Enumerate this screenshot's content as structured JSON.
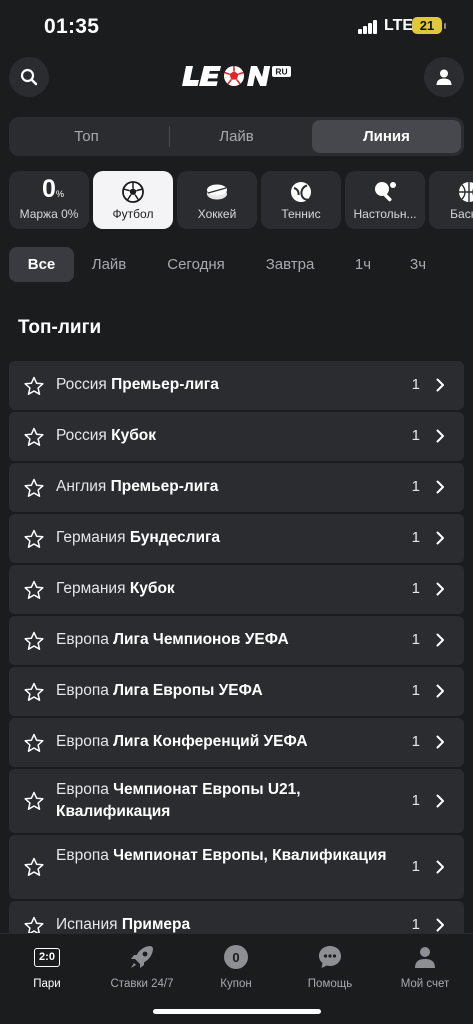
{
  "status": {
    "time": "01:35",
    "network": "LTE",
    "battery": "21"
  },
  "header": {
    "logo_text": "LEON",
    "logo_suffix": "RU"
  },
  "tabs": [
    {
      "label": "Топ",
      "active": false
    },
    {
      "label": "Лайв",
      "active": false
    },
    {
      "label": "Линия",
      "active": true
    }
  ],
  "sports": [
    {
      "label": "Маржа 0%",
      "value": "0",
      "unit": "%",
      "icon": "margin-icon",
      "active": false
    },
    {
      "label": "Футбол",
      "icon": "football-icon",
      "active": true
    },
    {
      "label": "Хоккей",
      "icon": "hockey-icon",
      "active": false
    },
    {
      "label": "Теннис",
      "icon": "tennis-icon",
      "active": false
    },
    {
      "label": "Настольн...",
      "icon": "table-tennis-icon",
      "active": false
    },
    {
      "label": "Баскет",
      "icon": "basketball-icon",
      "active": false
    }
  ],
  "filters": [
    {
      "label": "Все",
      "active": true
    },
    {
      "label": "Лайв",
      "active": false
    },
    {
      "label": "Сегодня",
      "active": false
    },
    {
      "label": "Завтра",
      "active": false
    },
    {
      "label": "1ч",
      "active": false
    },
    {
      "label": "3ч",
      "active": false
    }
  ],
  "section_title": "Топ-лиги",
  "leagues": [
    {
      "country": "Россия",
      "name": "Премьер-лига",
      "count": "1"
    },
    {
      "country": "Россия",
      "name": "Кубок",
      "count": "1"
    },
    {
      "country": "Англия",
      "name": "Премьер-лига",
      "count": "1"
    },
    {
      "country": "Германия",
      "name": "Бундеслига",
      "count": "1"
    },
    {
      "country": "Германия",
      "name": "Кубок",
      "count": "1"
    },
    {
      "country": "Европа",
      "name": "Лига Чемпионов УЕФА",
      "count": "1"
    },
    {
      "country": "Европа",
      "name": "Лига Европы УЕФА",
      "count": "1"
    },
    {
      "country": "Европа",
      "name": "Лига Конференций УЕФА",
      "count": "1"
    },
    {
      "country": "Европа",
      "name": "Чемпионат Европы U21, Квалификация",
      "count": "1"
    },
    {
      "country": "Европа",
      "name": "Чемпионат Европы, Квалификация",
      "count": "1"
    },
    {
      "country": "Испания",
      "name": "Примера",
      "count": "1"
    }
  ],
  "bottom_nav": [
    {
      "label": "Пари",
      "badge": "2:0",
      "icon": "score-icon",
      "active": true
    },
    {
      "label": "Ставки 24/7",
      "icon": "rocket-icon",
      "active": false
    },
    {
      "label": "Купон",
      "badge": "0",
      "icon": "coupon-icon",
      "active": false
    },
    {
      "label": "Помощь",
      "icon": "chat-icon",
      "active": false
    },
    {
      "label": "Мой счет",
      "icon": "user-icon",
      "active": false
    }
  ],
  "colors": {
    "background": "#1b1c1e",
    "card": "#2b2c2f",
    "active_chip": "#f4f4f6",
    "battery": "#e0c73b"
  }
}
